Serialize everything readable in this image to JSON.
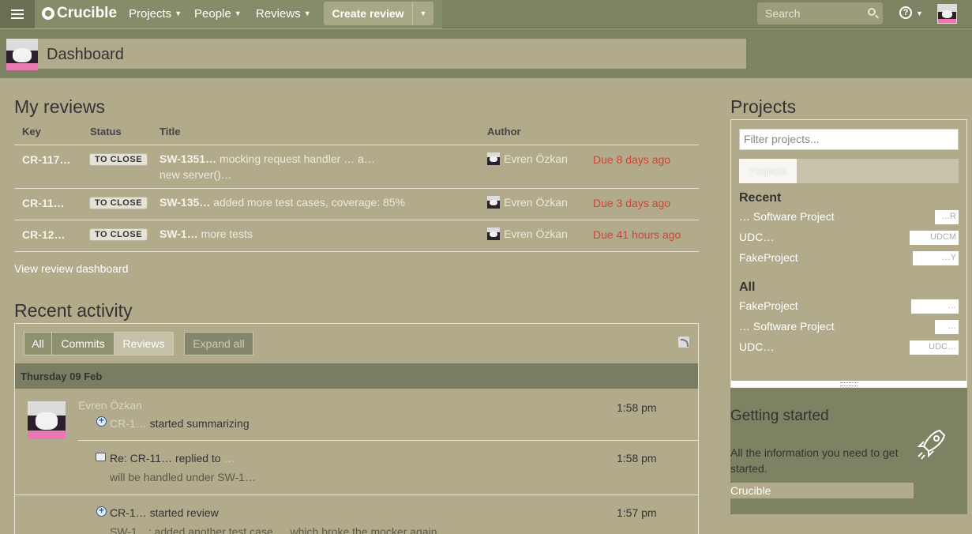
{
  "nav": {
    "logo": "Crucible",
    "projects": "Projects",
    "people": "People",
    "reviews": "Reviews",
    "create_review": "Create review",
    "search_placeholder": "Search",
    "help": "?"
  },
  "page": {
    "title": "Dashboard"
  },
  "my_reviews": {
    "heading": "My reviews",
    "columns": {
      "key": "Key",
      "status": "Status",
      "title": "Title",
      "author": "Author"
    },
    "rows": [
      {
        "key": "CR-117…",
        "status": "TO CLOSE",
        "title_key": "SW-1351…",
        "title_rest": "mocking request handler … a…",
        "title_line2": "new server()…",
        "author": "Evren Özkan",
        "due": "Due 8 days ago"
      },
      {
        "key": "CR-11…",
        "status": "TO CLOSE",
        "title_key": "SW-135…",
        "title_rest": "added more test cases, coverage: 85%",
        "title_line2": "",
        "author": "Evren Özkan",
        "due": "Due 3 days ago"
      },
      {
        "key": "CR-12…",
        "status": "TO CLOSE",
        "title_key": "SW-1…",
        "title_rest": "more tests",
        "title_line2": "",
        "author": "Evren Özkan",
        "due": "Due 41 hours ago"
      }
    ],
    "view_dashboard": "View review dashboard"
  },
  "recent_activity": {
    "heading": "Recent activity",
    "tabs": {
      "all": "All",
      "commits": "Commits",
      "reviews": "Reviews"
    },
    "expand_all": "Expand all",
    "day": "Thursday 09 Feb",
    "actor": "Evren Özkan",
    "items": [
      {
        "text_key": "CR-1…",
        "text": "started summarizing",
        "sub": "",
        "time": "1:58 pm"
      },
      {
        "text_key": "Re: CR-11…",
        "text": "replied to",
        "target": "…",
        "sub": "will be handled under SW-1…",
        "time": "1:58 pm"
      },
      {
        "text_key": "CR-1…",
        "text": "started review",
        "sub": "SW-1…: added another test case … which broke the mocker again",
        "time": "1:57 pm"
      }
    ]
  },
  "projects": {
    "heading": "Projects",
    "filter_placeholder": "Filter projects...",
    "tab": "Projects",
    "recent_heading": "Recent",
    "recent": [
      {
        "name": "… Software Project",
        "key": "…R"
      },
      {
        "name": "UDC…",
        "key": "UDCM"
      },
      {
        "name": "FakeProject",
        "key": "…Y"
      }
    ],
    "all_heading": "All",
    "all": [
      {
        "name": "FakeProject",
        "key": "…"
      },
      {
        "name": "… Software Project",
        "key": "…"
      },
      {
        "name": "UDC…",
        "key": "UDC…"
      }
    ]
  },
  "getting_started": {
    "heading": "Getting started",
    "text": "All the information you need to get started.",
    "link": "Crucible"
  }
}
